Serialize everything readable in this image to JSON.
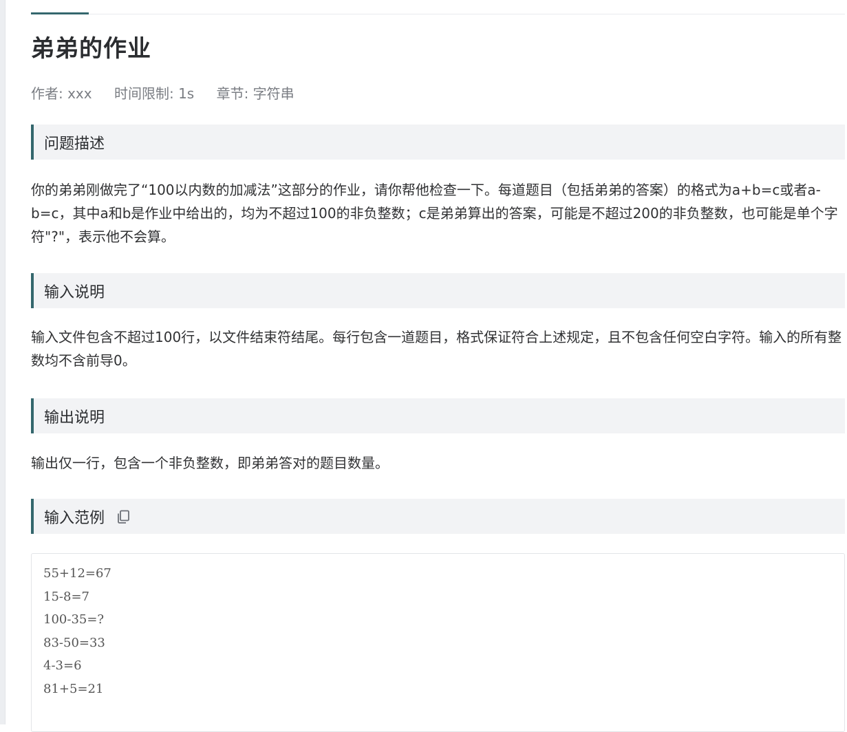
{
  "problem": {
    "title": "弟弟的作业",
    "meta": {
      "author": "作者: xxx",
      "time_limit": "时间限制: 1s",
      "chapter": "章节: 字符串"
    },
    "sections": {
      "description": {
        "heading": "问题描述",
        "text": "你的弟弟刚做完了“100以内数的加减法”这部分的作业，请你帮他检查一下。每道题目（包括弟弟的答案）的格式为a+b=c或者a-b=c，其中a和b是作业中给出的，均为不超过100的非负整数；c是弟弟算出的答案，可能是不超过200的非负整数，也可能是单个字符\"?\"，表示他不会算。"
      },
      "input": {
        "heading": "输入说明",
        "text": "输入文件包含不超过100行，以文件结束符结尾。每行包含一道题目，格式保证符合上述规定，且不包含任何空白字符。输入的所有整数均不含前导0。"
      },
      "output": {
        "heading": "输出说明",
        "text": "输出仅一行，包含一个非负整数，即弟弟答对的题目数量。"
      },
      "sample_input": {
        "heading": "输入范例",
        "copy_icon": "copy-icon",
        "lines": [
          "55+12=67",
          "15-8=7",
          "100-35=?",
          "83-50=33",
          "4-3=6",
          "81+5=21"
        ]
      }
    }
  },
  "colors": {
    "accent": "#34676d",
    "header_bg": "#f2f3f5",
    "meta_text": "#7a7d83"
  }
}
